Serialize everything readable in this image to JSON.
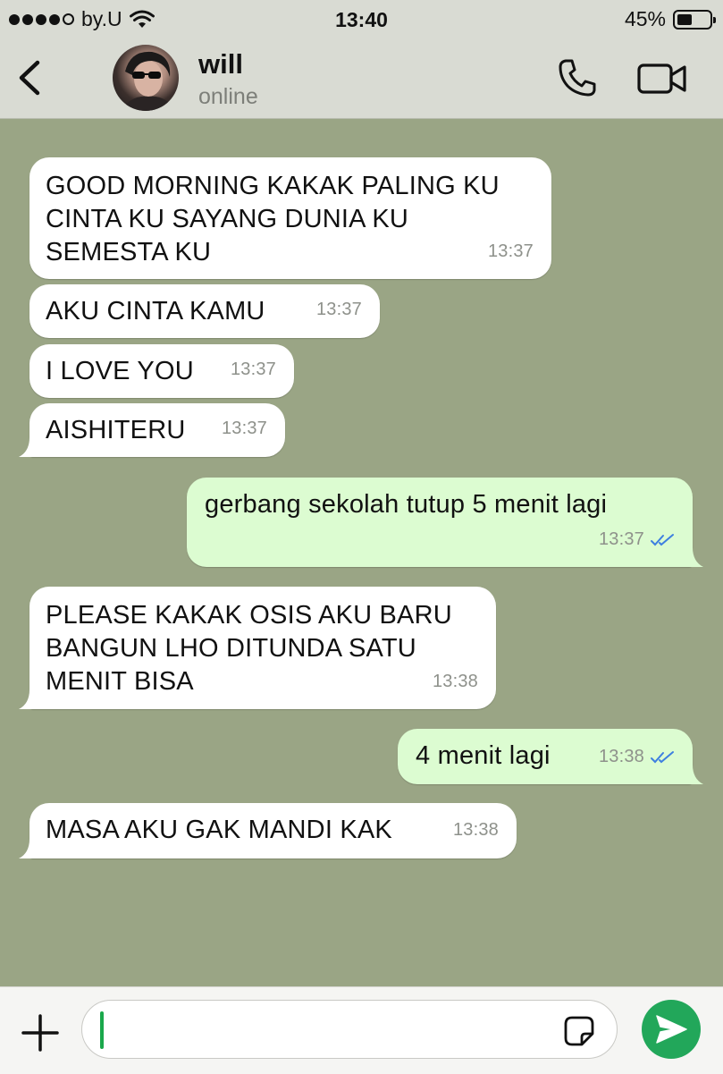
{
  "status_bar": {
    "carrier": "by.U",
    "time": "13:40",
    "battery_percent": "45%",
    "battery_level": 0.45,
    "signal_bars_filled": 4,
    "signal_bars_total": 5
  },
  "header": {
    "contact_name": "will",
    "contact_status": "online",
    "icons": [
      "back-chevron-icon",
      "phone-icon",
      "video-camera-icon"
    ]
  },
  "messages": [
    {
      "direction": "incoming",
      "text": "GOOD MORNING KAKAK PALING KU\nCINTA KU SAYANG DUNIA KU\nSEMESTA KU",
      "time": "13:37"
    },
    {
      "direction": "incoming",
      "text": "AKU CINTA KAMU",
      "time": "13:37"
    },
    {
      "direction": "incoming",
      "text": "I LOVE YOU",
      "time": "13:37"
    },
    {
      "direction": "incoming",
      "text": "AISHITERU",
      "time": "13:37"
    },
    {
      "direction": "outgoing",
      "text": "gerbang sekolah tutup 5 menit lagi",
      "time": "13:37",
      "status": "read"
    },
    {
      "direction": "incoming",
      "text": "PLEASE KAKAK OSIS AKU BARU\nBANGUN LHO DITUNDA SATU\nMENIT BISA",
      "time": "13:38"
    },
    {
      "direction": "outgoing",
      "text": "4 menit lagi",
      "time": "13:38",
      "status": "read"
    },
    {
      "direction": "incoming",
      "text": "MASA AKU GAK MANDI KAK",
      "time": "13:38"
    }
  ],
  "input_bar": {
    "placeholder": "",
    "value": "",
    "icons": [
      "plus-icon",
      "sticker-icon",
      "send-icon"
    ]
  },
  "colors": {
    "chat_background": "#9aa585",
    "incoming_bubble": "#ffffff",
    "outgoing_bubble": "#dcfcd1",
    "read_checks": "#3d7fe0",
    "send_button": "#22a75a",
    "cursor": "#1aa84b"
  }
}
